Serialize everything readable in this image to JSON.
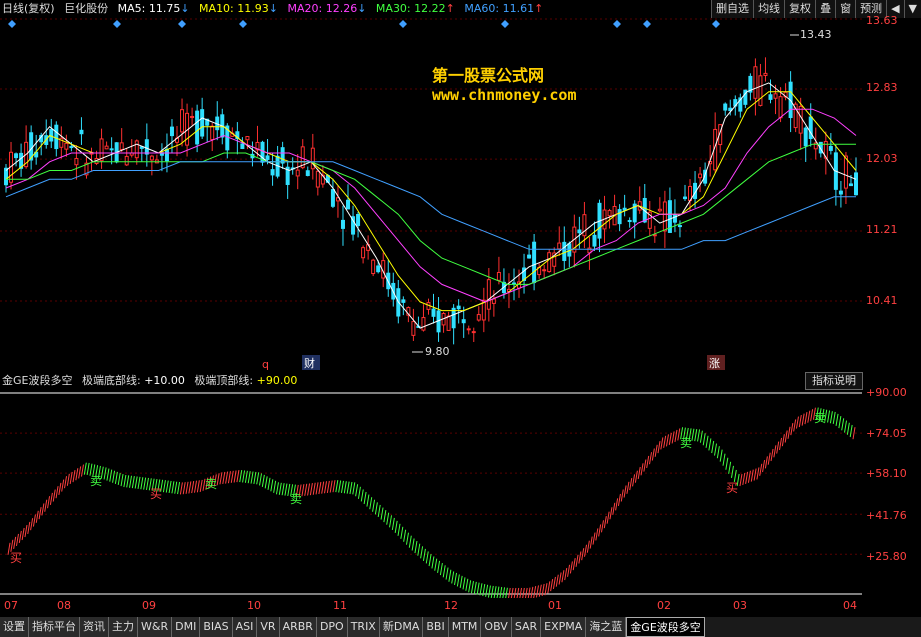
{
  "top_bar": {
    "period": "日线(复权)",
    "stock_name": "巨化股份",
    "ma5": {
      "label": "MA5:",
      "value": "11.75",
      "arrow": "↓",
      "color": "#ffffff"
    },
    "ma10": {
      "label": "MA10:",
      "value": "11.93",
      "arrow": "↓",
      "color": "#ffff00"
    },
    "ma20": {
      "label": "MA20:",
      "value": "12.26",
      "arrow": "↓",
      "color": "#ff40ff"
    },
    "ma30": {
      "label": "MA30:",
      "value": "12.22",
      "arrow": "↑",
      "color": "#40ff40"
    },
    "ma60": {
      "label": "MA60:",
      "value": "11.61",
      "arrow": "↑",
      "color": "#40a0ff"
    },
    "buttons": [
      "删自选",
      "均线",
      "复权",
      "叠",
      "窗",
      "预测",
      "◀",
      "▼"
    ]
  },
  "watermark": {
    "line1": "第一股票公式网",
    "line2": "www.chnmoney.com"
  },
  "main_chart": {
    "price_axis": [
      "13.63",
      "12.83",
      "12.03",
      "11.21",
      "10.41"
    ],
    "high_annotation": "13.43",
    "low_annotation": "9.80",
    "markers": [
      "q",
      "财",
      "涨"
    ]
  },
  "indicator": {
    "name": "金GE波段多空",
    "params": "极端底部线: +10.00  极端顶部线: +90.00",
    "param_label1": "极端底部线:",
    "param_val1": "+10.00",
    "param_label2": "极端顶部线:",
    "param_val2": "+90.00",
    "help_button": "指标说明",
    "axis": [
      "+90.00",
      "+74.05",
      "+58.10",
      "+41.76",
      "+25.80"
    ],
    "signals": [
      "买",
      "卖",
      "买",
      "卖",
      "卖",
      "卖",
      "买",
      "卖"
    ]
  },
  "date_axis": [
    "07",
    "08",
    "09",
    "10",
    "11",
    "12",
    "01",
    "02",
    "03",
    "04"
  ],
  "tabs": [
    "设置",
    "指标平台",
    "资讯",
    "主力",
    "W&R",
    "DMI",
    "BIAS",
    "ASI",
    "VR",
    "ARBR",
    "DPO",
    "TRIX",
    "新DMA",
    "BBI",
    "MTM",
    "OBV",
    "SAR",
    "EXPMA",
    "海之蓝",
    "金GE波段多空"
  ],
  "active_tab": "金GE波段多空",
  "chart_data": {
    "type": "line",
    "series": [
      {
        "name": "MA5",
        "values": [
          11.9,
          12.1,
          12.4,
          12.2,
          12.0,
          12.1,
          12.2,
          12.1,
          12.3,
          12.5,
          12.4,
          12.2,
          12.0,
          11.9,
          12.0,
          11.7,
          11.3,
          10.9,
          10.4,
          10.1,
          10.2,
          10.3,
          10.4,
          10.6,
          10.8,
          10.9,
          11.1,
          11.3,
          11.4,
          11.5,
          11.3,
          11.4,
          11.8,
          12.5,
          12.8,
          12.9,
          12.7,
          12.3,
          11.9,
          11.8
        ]
      },
      {
        "name": "MA10",
        "values": [
          11.8,
          12.0,
          12.3,
          12.2,
          12.1,
          12.1,
          12.1,
          12.1,
          12.2,
          12.4,
          12.4,
          12.2,
          12.1,
          12.0,
          12.0,
          11.8,
          11.5,
          11.1,
          10.7,
          10.4,
          10.3,
          10.3,
          10.4,
          10.5,
          10.7,
          10.9,
          11.0,
          11.2,
          11.4,
          11.5,
          11.4,
          11.4,
          11.6,
          12.1,
          12.6,
          12.8,
          12.8,
          12.5,
          12.2,
          11.9
        ]
      },
      {
        "name": "MA20",
        "values": [
          11.7,
          11.8,
          12.0,
          12.1,
          12.1,
          12.1,
          12.1,
          12.1,
          12.1,
          12.2,
          12.3,
          12.2,
          12.1,
          12.1,
          12.0,
          11.9,
          11.7,
          11.4,
          11.1,
          10.8,
          10.6,
          10.5,
          10.4,
          10.5,
          10.6,
          10.7,
          10.8,
          11.0,
          11.1,
          11.3,
          11.4,
          11.4,
          11.5,
          11.7,
          12.1,
          12.4,
          12.6,
          12.6,
          12.5,
          12.3
        ]
      },
      {
        "name": "MA30",
        "values": [
          11.8,
          11.8,
          11.9,
          11.9,
          12.0,
          12.0,
          12.0,
          12.0,
          12.0,
          12.0,
          12.1,
          12.1,
          12.0,
          12.0,
          12.0,
          11.9,
          11.8,
          11.6,
          11.4,
          11.1,
          10.9,
          10.8,
          10.7,
          10.6,
          10.6,
          10.7,
          10.8,
          10.9,
          11.0,
          11.1,
          11.2,
          11.3,
          11.4,
          11.6,
          11.8,
          12.0,
          12.1,
          12.2,
          12.2,
          12.2
        ]
      },
      {
        "name": "MA60",
        "values": [
          11.6,
          11.7,
          11.8,
          11.8,
          11.9,
          11.9,
          11.9,
          11.9,
          12.0,
          12.0,
          12.0,
          12.0,
          12.0,
          12.0,
          12.0,
          12.0,
          11.9,
          11.8,
          11.7,
          11.6,
          11.4,
          11.3,
          11.2,
          11.1,
          11.0,
          11.0,
          11.0,
          11.0,
          11.0,
          11.0,
          11.0,
          11.0,
          11.1,
          11.1,
          11.2,
          11.3,
          11.4,
          11.5,
          11.6,
          11.6
        ]
      }
    ],
    "indicator_values": [
      28,
      36,
      46,
      55,
      60,
      58,
      55,
      54,
      53,
      52,
      53,
      56,
      57,
      56,
      52,
      51,
      52,
      53,
      52,
      45,
      38,
      30,
      23,
      17,
      13,
      11,
      10,
      10,
      12,
      18,
      27,
      38,
      50,
      60,
      70,
      74,
      73,
      66,
      55,
      58,
      68,
      78,
      82,
      80,
      74
    ]
  }
}
